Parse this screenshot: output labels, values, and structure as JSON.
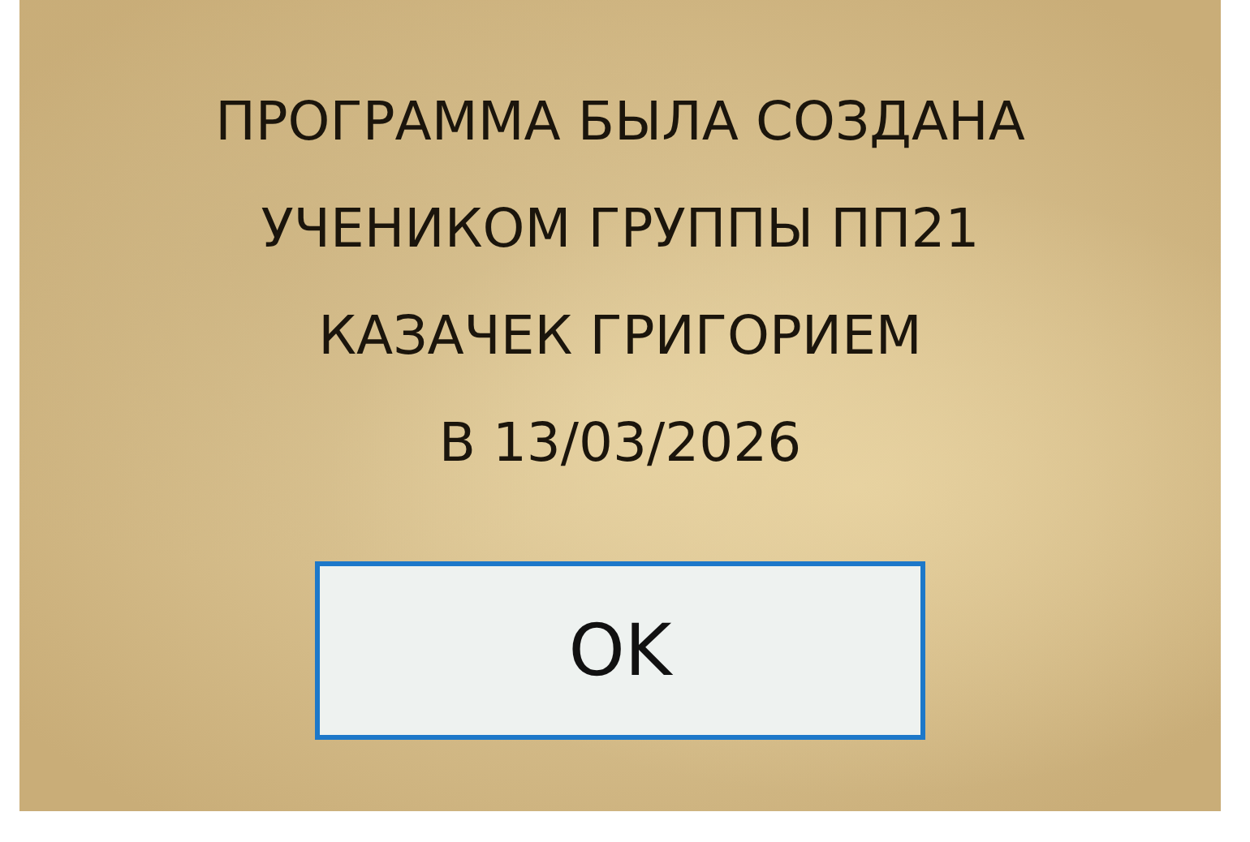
{
  "message": {
    "lines": [
      "ПРОГРАММА БЫЛА СОЗДАНА",
      "УЧЕНИКОМ ГРУППЫ ПП21",
      "КАЗАЧЕК ГРИГОРИЕМ",
      "В 13/03/2026"
    ]
  },
  "buttons": [
    {
      "label": "OK"
    }
  ]
}
